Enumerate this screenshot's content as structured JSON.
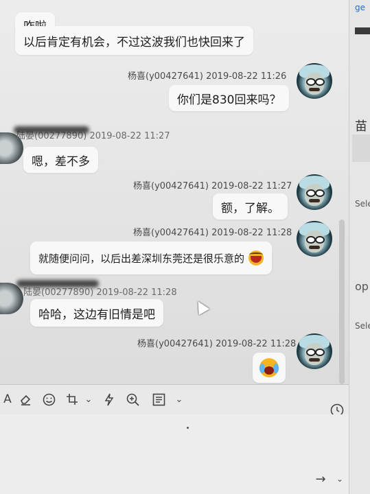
{
  "messages": [
    {
      "text": "咋啦"
    },
    {
      "text": "以后肯定有机会，不过这波我们也快回来了"
    },
    {
      "sender": "杨喜(y00427641) 2019-08-22 11:26",
      "text": "你们是830回来吗？"
    },
    {
      "sender": "陆晏(00277890) 2019-08-22 11:27",
      "text": "嗯，差不多"
    },
    {
      "sender": "杨喜(y00427641) 2019-08-22 11:27",
      "text": "额，了解。"
    },
    {
      "sender": "杨喜(y00427641) 2019-08-22 11:28",
      "text": "就随便问问，以后出差深圳东莞还是很乐意的"
    },
    {
      "sender": "陆晏(00277890) 2019-08-22 11:28",
      "text": "哈哈，这边有旧情是吧"
    },
    {
      "sender": "杨喜(y00427641) 2019-08-22 11:28"
    }
  ],
  "side_panel": {
    "items": [
      "ge",
      "苗",
      "Sele",
      "op",
      "Sele"
    ]
  },
  "toolbar": {
    "font_glyph": "A",
    "dropdown_glyph": "⌄",
    "send_arrow": "→"
  },
  "icons": [
    "font-icon",
    "eraser-icon",
    "emoji-icon",
    "crop-icon",
    "flash-icon",
    "zoom-icon",
    "template-icon",
    "clock-icon",
    "send-icon",
    "laugh-emoji-icon",
    "cry-laugh-emoji-icon"
  ]
}
